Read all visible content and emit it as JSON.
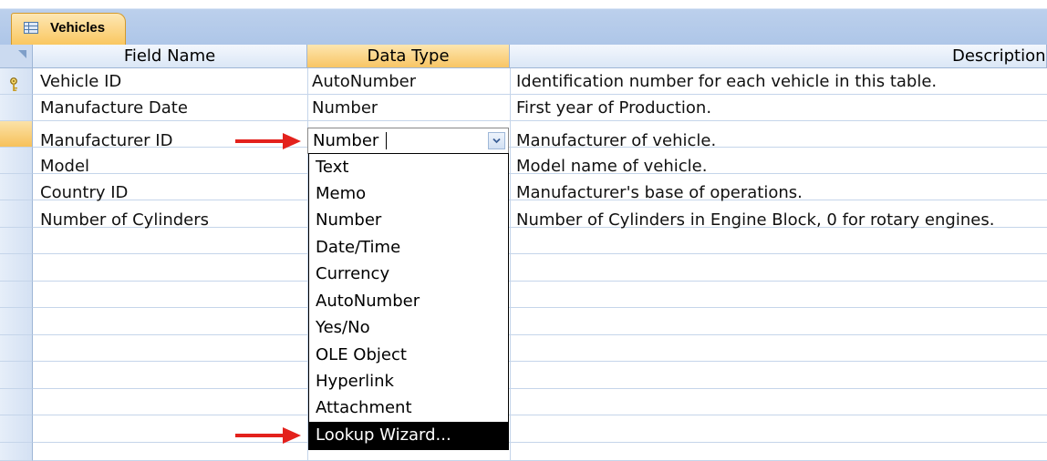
{
  "table_tab": {
    "title": "Vehicles",
    "icon": "table-icon"
  },
  "columns": {
    "field_name": "Field Name",
    "data_type": "Data Type",
    "description": "Description"
  },
  "rows": [
    {
      "field_name": "Vehicle ID",
      "data_type": "AutoNumber",
      "description": "Identification number for each vehicle in this table.",
      "primary_key": true
    },
    {
      "field_name": "Manufacture Date",
      "data_type": "Number",
      "description": "First year of Production."
    },
    {
      "field_name": "Manufacturer ID",
      "data_type": "Number",
      "description": "Manufacturer of vehicle.",
      "active": true
    },
    {
      "field_name": "Model",
      "data_type": "",
      "description": "Model name of vehicle."
    },
    {
      "field_name": "Country ID",
      "data_type": "",
      "description": "Manufacturer's base of operations."
    },
    {
      "field_name": "Number of Cylinders",
      "data_type": "",
      "description": "Number of Cylinders in Engine Block, 0 for rotary engines."
    }
  ],
  "data_type_dropdown": {
    "current_value": "Number",
    "options": [
      "Text",
      "Memo",
      "Number",
      "Date/Time",
      "Currency",
      "AutoNumber",
      "Yes/No",
      "OLE Object",
      "Hyperlink",
      "Attachment",
      "Lookup Wizard..."
    ],
    "highlighted": "Lookup Wizard..."
  },
  "annotations": {
    "arrow_color": "#e3211c"
  },
  "colors": {
    "active_header": "#f8c564",
    "grid_line": "#c5d5ea",
    "tab_strip": "#aec6e8"
  }
}
